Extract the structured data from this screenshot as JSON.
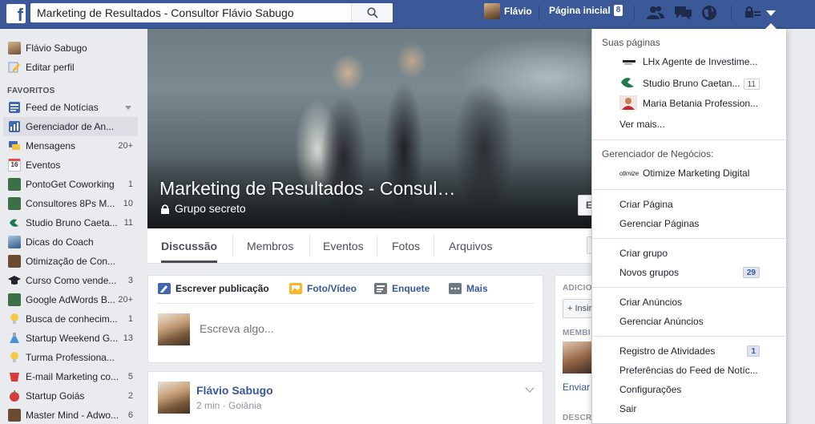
{
  "topbar": {
    "search_value": "Marketing de Resultados - Consultor Flávio Sabugo",
    "user_name": "Flávio",
    "home_label": "Página inicial",
    "home_count": "8",
    "icons": [
      "facebook-logo",
      "search-icon",
      "friend-requests-icon",
      "messages-icon",
      "notifications-globe-icon",
      "privacy-lock-icon",
      "account-menu-caret-icon"
    ]
  },
  "sidebar": {
    "profile_name": "Flávio Sabugo",
    "edit_profile": "Editar perfil",
    "favorites_header": "FAVORITOS",
    "items": [
      {
        "label": "Feed de Notícias",
        "count": ""
      },
      {
        "label": "Gerenciador de An...",
        "count": ""
      },
      {
        "label": "Mensagens",
        "count": "20+"
      },
      {
        "label": "Eventos",
        "count": ""
      },
      {
        "label": "PontoGet Coworking",
        "count": "1"
      },
      {
        "label": "Consultores 8Ps M...",
        "count": "10"
      },
      {
        "label": "Studio Bruno Caeta...",
        "count": "11"
      },
      {
        "label": "Dicas do Coach",
        "count": ""
      },
      {
        "label": "Otimização de Con...",
        "count": ""
      },
      {
        "label": "Curso Como vende...",
        "count": "3"
      },
      {
        "label": "Google AdWords B...",
        "count": "20+"
      },
      {
        "label": "Busca de conhecim...",
        "count": "1"
      },
      {
        "label": "Startup Weekend G...",
        "count": "13"
      },
      {
        "label": "Turma Professiona...",
        "count": ""
      },
      {
        "label": "E-mail Marketing co...",
        "count": "5"
      },
      {
        "label": "Startup Goiás",
        "count": "2"
      },
      {
        "label": "Master Mind - Adwo...",
        "count": "6"
      }
    ],
    "event_day": "16"
  },
  "cover": {
    "title": "Marketing de Resultados - Consul…",
    "privacy": "Grupo secreto",
    "button_partial": "E"
  },
  "tabs": [
    "Discussão",
    "Membros",
    "Eventos",
    "Fotos",
    "Arquivos"
  ],
  "composer": {
    "tabs": [
      "Escrever publicação",
      "Foto/Vídeo",
      "Enquete",
      "Mais"
    ],
    "placeholder": "Escreva algo..."
  },
  "post": {
    "author": "Flávio Sabugo",
    "meta": "2 min · Goiânia"
  },
  "right_column": {
    "add_header": "ADICIO",
    "add_button": "+ Insir",
    "members_header": "MEMBI",
    "send_link": "Enviar",
    "desc_header": "DESCR"
  },
  "dropdown": {
    "your_pages_header": "Suas páginas",
    "pages": [
      {
        "label": "LHx Agente de Investime...",
        "count": ""
      },
      {
        "label": "Studio Bruno Caetan...",
        "count": "11"
      },
      {
        "label": "Maria Betania Profession...",
        "count": ""
      }
    ],
    "see_more": "Ver mais...",
    "business_header": "Gerenciador de Negócios:",
    "business_item": "Otimize Marketing Digital",
    "business_logo_text": "otimize",
    "create_page": "Criar Página",
    "manage_pages": "Gerenciar Páginas",
    "create_group": "Criar grupo",
    "new_groups": "Novos grupos",
    "new_groups_count": "29",
    "create_ads": "Criar Anúncios",
    "manage_ads": "Gerenciar Anúncios",
    "activity_log": "Registro de Atividades",
    "activity_count": "1",
    "feed_prefs": "Preferências do Feed de Notíc...",
    "settings": "Configurações",
    "logout": "Sair"
  },
  "colors": {
    "brand_blue": "#3b5998",
    "link_blue": "#365899",
    "page_bg": "#e9ebee"
  }
}
